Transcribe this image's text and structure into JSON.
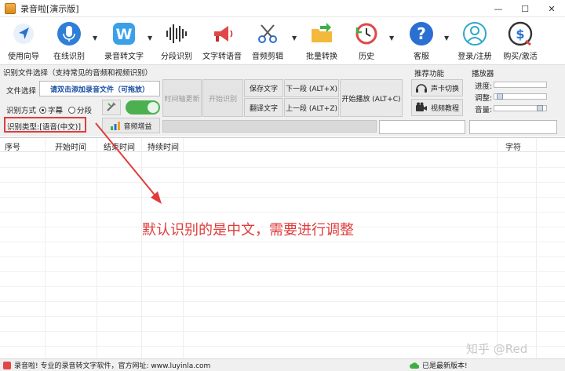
{
  "window": {
    "title": "录音啦[演示版]",
    "minimize": "—",
    "maximize": "☐",
    "close": "✕"
  },
  "toolbar": {
    "items": [
      {
        "label": "使用向导",
        "icon": "navigation-arrow-icon"
      },
      {
        "label": "在线识别",
        "icon": "microphone-icon"
      },
      {
        "label": "录音转文字",
        "icon": "w-letter-icon"
      },
      {
        "label": "分段识别",
        "icon": "waveform-icon"
      },
      {
        "label": "文字转语音",
        "icon": "megaphone-icon"
      },
      {
        "label": "音频剪辑",
        "icon": "scissors-icon"
      },
      {
        "label": "批量转换",
        "icon": "folder-arrow-icon"
      },
      {
        "label": "历史",
        "icon": "history-clock-icon"
      },
      {
        "label": "客服",
        "icon": "help-question-icon"
      },
      {
        "label": "登录/注册",
        "icon": "user-icon"
      },
      {
        "label": "购买/激活",
        "icon": "dollar-icon"
      }
    ]
  },
  "panel": {
    "section_title": "识别文件选择（支持常见的音频和视频识别）",
    "file_select_label": "文件选择",
    "add_file_button": "请双击添加录音文件（可拖放）",
    "mode_label": "识别方式",
    "mode_subtitle": "字幕",
    "mode_segment": "分段",
    "type_label": "识别类型:[语音(中文)]",
    "audio_boost": "音频增益",
    "timeline_update": "时间轴更新",
    "start_recognition": "开始识别",
    "save_text": "保存文字",
    "translate_text": "翻译文字",
    "next_segment": "下一段 (ALT+X)",
    "prev_segment": "上一段 (ALT+Z)",
    "start_play": "开始播放 (ALT+C)",
    "recommend_title": "推荐功能",
    "soundcard_switch": "声卡切换",
    "video_tutorial": "视频教程",
    "player_title": "播放器",
    "progress_label": "进度:",
    "adjust_label": "调整:",
    "volume_label": "音量:",
    "adjust_level": 0.05,
    "volume_level": 0.93
  },
  "table": {
    "columns": [
      "序号",
      "开始时间",
      "结束时间",
      "持续时间",
      "字符"
    ]
  },
  "annotation": "默认识别的是中文，需要进行调整",
  "status": {
    "left": "录音啦! 专业的录音转文字软件，官方网址: www.luyinla.com",
    "right": "已是最新版本!"
  },
  "watermark": "知乎 @Red",
  "colors": {
    "annotation_red": "#e03c3c",
    "toggle_green": "#4caf50",
    "link_blue": "#1a4fa3"
  }
}
